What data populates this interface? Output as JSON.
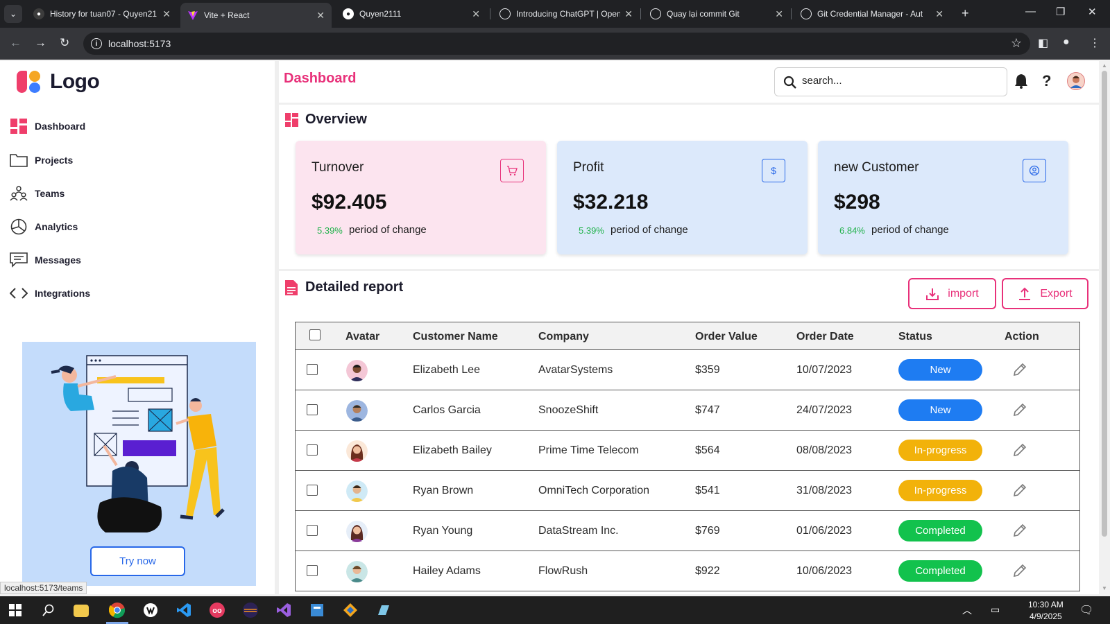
{
  "browser": {
    "tabs": [
      {
        "title": "History for tuan07 - Quyen21",
        "favicon": "github-icon"
      },
      {
        "title": "Vite + React",
        "favicon": "vite-icon",
        "active": true
      },
      {
        "title": "Quyen2111",
        "favicon": "github-icon"
      },
      {
        "title": "Introducing ChatGPT | Open",
        "favicon": "openai-icon"
      },
      {
        "title": "Quay lại commit Git",
        "favicon": "openai-icon"
      },
      {
        "title": "Git Credential Manager - Aut",
        "favicon": "globe-icon"
      }
    ],
    "url": "localhost:5173",
    "status_url": "localhost:5173/teams"
  },
  "sidebar": {
    "logo_text": "Logo",
    "items": [
      {
        "label": "Dashboard",
        "icon": "dashboard-icon",
        "active": true
      },
      {
        "label": "Projects",
        "icon": "folder-icon"
      },
      {
        "label": "Teams",
        "icon": "teams-icon"
      },
      {
        "label": "Analytics",
        "icon": "pie-chart-icon"
      },
      {
        "label": "Messages",
        "icon": "message-icon"
      },
      {
        "label": "Integrations",
        "icon": "code-icon"
      }
    ],
    "promo_button": "Try now"
  },
  "header": {
    "title": "Dashboard",
    "search_placeholder": "search..."
  },
  "overview": {
    "title": "Overview",
    "cards": [
      {
        "title": "Turnover",
        "value": "$92.405",
        "pct": "5.39%",
        "change_label": "period of change",
        "icon": "cart-icon",
        "bg": "#fce4ef",
        "accent": "#e8317a"
      },
      {
        "title": "Profit",
        "value": "$32.218",
        "pct": "5.39%",
        "change_label": "period of change",
        "icon": "dollar-icon",
        "bg": "#dce9fb",
        "accent": "#2767e8"
      },
      {
        "title": "new Customer",
        "value": "$298",
        "pct": "6.84%",
        "change_label": "period of change",
        "icon": "user-circle-icon",
        "bg": "#dce9fb",
        "accent": "#2767e8"
      }
    ]
  },
  "report": {
    "title": "Detailed report",
    "import_label": "import",
    "export_label": "Export",
    "columns": [
      "Avatar",
      "Customer Name",
      "Company",
      "Order Value",
      "Order Date",
      "Status",
      "Action"
    ],
    "rows": [
      {
        "name": "Elizabeth Lee",
        "company": "AvatarSystems",
        "value": "$359",
        "date": "10/07/2023",
        "status": "New"
      },
      {
        "name": "Carlos Garcia",
        "company": "SnoozeShift",
        "value": "$747",
        "date": "24/07/2023",
        "status": "New"
      },
      {
        "name": "Elizabeth Bailey",
        "company": "Prime Time Telecom",
        "value": "$564",
        "date": "08/08/2023",
        "status": "In-progress"
      },
      {
        "name": "Ryan Brown",
        "company": "OmniTech Corporation",
        "value": "$541",
        "date": "31/08/2023",
        "status": "In-progress"
      },
      {
        "name": "Ryan Young",
        "company": "DataStream Inc.",
        "value": "$769",
        "date": "01/06/2023",
        "status": "Completed"
      },
      {
        "name": "Hailey Adams",
        "company": "FlowRush",
        "value": "$922",
        "date": "10/06/2023",
        "status": "Completed"
      }
    ],
    "status_colors": {
      "New": "#1e7cf2",
      "In-progress": "#f2b20a",
      "Completed": "#12c24d"
    }
  },
  "taskbar": {
    "time": "10:30 AM",
    "date": "4/9/2025"
  }
}
